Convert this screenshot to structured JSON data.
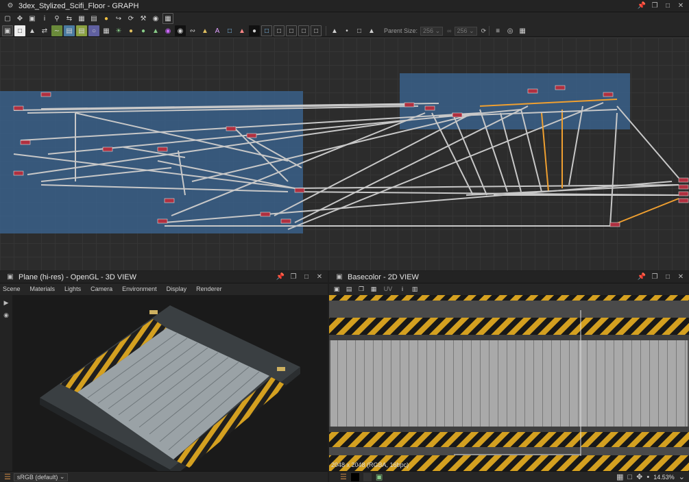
{
  "graph": {
    "title": "3dex_Stylized_Scifi_Floor - GRAPH",
    "parent_size_label": "Parent Size:",
    "parent_size_value": "256",
    "output_size_value": "256"
  },
  "view3d": {
    "title": "Plane (hi-res) - OpenGL - 3D VIEW",
    "menu": [
      "Scene",
      "Materials",
      "Lights",
      "Camera",
      "Environment",
      "Display",
      "Renderer"
    ]
  },
  "view2d": {
    "title": "Basecolor - 2D VIEW",
    "uv_label": "UV",
    "image_info": "2048 x 2048 (RGBA, 16bpc)",
    "zoom": "14.53%"
  },
  "status": {
    "colorspace": "sRGB (default)"
  },
  "colors": {
    "frame_blue": "#3a608a",
    "link_gray": "#c8c8c8",
    "link_orange": "#f0a030",
    "hazard_yellow": "#d4a020"
  }
}
